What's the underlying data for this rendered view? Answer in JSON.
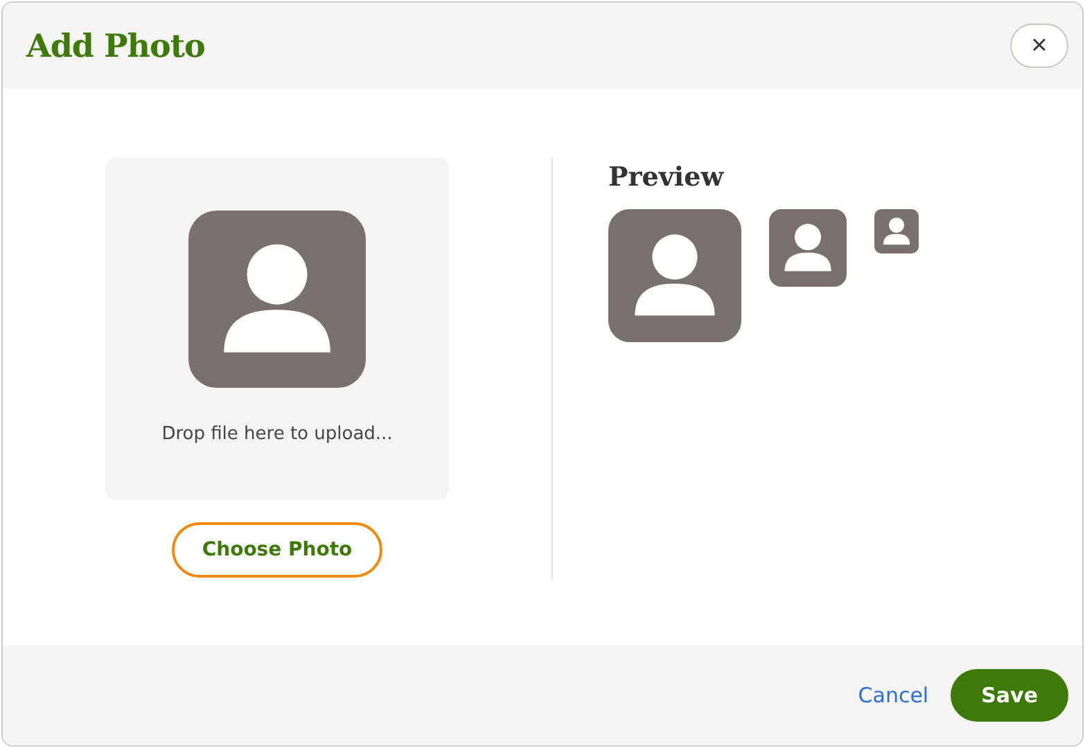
{
  "dialog": {
    "title": "Add Photo",
    "close": "×"
  },
  "upload": {
    "drop_text": "Drop file here to upload...",
    "button": {
      "label": "Choose Photo",
      "focused": true
    }
  },
  "preview": {
    "title": "Preview"
  },
  "footer": {
    "cancel": "Cancel",
    "save": "Save"
  }
}
